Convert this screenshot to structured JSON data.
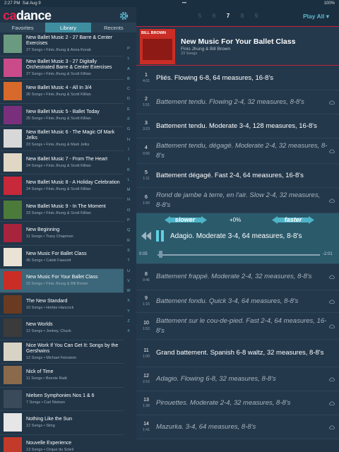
{
  "status": {
    "time": "2:27 PM",
    "date": "Sat Aug 9",
    "dots": "•••",
    "battery": "100%"
  },
  "app": {
    "logo_c": "ca",
    "logo_d": "dance",
    "accent": "#e0224f"
  },
  "tabs": [
    "Favorites",
    "Library",
    "Recents"
  ],
  "library": [
    {
      "title": "New Ballet Music 2 - 27 Barre & Center Exercises",
      "meta": "27 Songs • Finis Jhung & Anna Korab",
      "color": "#6a9a7f"
    },
    {
      "title": "New Ballet Music 3 - 27 Digitally Orchestrated Barre & Center Exercises",
      "meta": "27 Songs • Finis Jhung & Scott Killian",
      "color": "#c94b8a"
    },
    {
      "title": "New Ballet Music 4 - All In 3/4",
      "meta": "26 Songs • Finis Jhung & Scott Killian",
      "color": "#d76a2b"
    },
    {
      "title": "New Ballet Music 5 - Ballet Today",
      "meta": "25 Songs • Finis Jhung & Scott Killian",
      "color": "#7a2f7c"
    },
    {
      "title": "New Ballet Music 6 - The Magic Of Mark Jelks",
      "meta": "23 Songs • Finis Jhung & Mark Jelks",
      "color": "#d8d8d8"
    },
    {
      "title": "New Ballet Music 7 - From The Heart",
      "meta": "24 Songs • Finis Jhung & Scott Killian",
      "color": "#e0d7c4"
    },
    {
      "title": "New Ballet Music 8 - A Holiday Celebration",
      "meta": "24 Songs • Finis Jhung & Scott Killian",
      "color": "#c7283a"
    },
    {
      "title": "New Ballet Music 9 - In The Moment",
      "meta": "23 Songs • Finis Jhung & Scott Killian",
      "color": "#4c7a3a"
    },
    {
      "title": "New Beginning",
      "meta": "11 Songs • Tracy Chapman",
      "color": "#a8233c"
    },
    {
      "title": "New Music For Ballet Class",
      "meta": "45 Songs • Caleb Fawcett",
      "color": "#e9e2d5"
    },
    {
      "title": "New Music For Your Ballet Class",
      "meta": "23 Songs • Finis Jhung & Bill Brown",
      "color": "#c92d25"
    },
    {
      "title": "The New Standard",
      "meta": "10 Songs • Herbie Hancock",
      "color": "#6b3b21"
    },
    {
      "title": "New Worlds",
      "meta": "12 Songs • Jonkey, Chuck",
      "color": "#3b3b3b"
    },
    {
      "title": "Nice Work If You Can Get It: Songs by the Gershwins",
      "meta": "12 Songs • Michael Feinstein",
      "color": "#d9d3c5"
    },
    {
      "title": "Nick of Time",
      "meta": "11 Songs • Bonnie Raitt",
      "color": "#8a6a4a"
    },
    {
      "title": "Nielsen Symphonies Nos 1 & 6",
      "meta": "7 Songs • Carl Nielsen",
      "color": "#3a4a5a"
    },
    {
      "title": "Nothing Like the Sun",
      "meta": "12 Songs • Sting",
      "color": "#e6e6e6"
    },
    {
      "title": "Nouvelle Experience",
      "meta": "13 Songs • Cirque du Soleil",
      "color": "#c23a2a"
    }
  ],
  "alphabet": [
    "P",
    "L",
    "A",
    "B",
    "C",
    "D",
    "E",
    "F",
    "G",
    "H",
    "I",
    "J",
    "K",
    "L",
    "M",
    "N",
    "O",
    "P",
    "Q",
    "R",
    "S",
    "T",
    "U",
    "V",
    "W",
    "X",
    "Y",
    "Z",
    "#"
  ],
  "pages": [
    "5",
    "6",
    "7",
    "8",
    "9"
  ],
  "play_all": "Play All",
  "album": {
    "title": "New Music For Your Ballet Class",
    "artist": "Finis Jhung & Bill Brown",
    "count": "23 Songs",
    "cover_text": "BILL BROWN"
  },
  "tracks": [
    {
      "n": "1",
      "d": "4:01",
      "title": "Pliés. Flowing 6-8, 64 measures, 16-8's",
      "italic": false,
      "h": 34
    },
    {
      "n": "2",
      "d": "1:51",
      "title": "Battement tendu. Flowing 2-4, 32 measures, 8-8's",
      "italic": true,
      "h": 34
    },
    {
      "n": "3",
      "d": "3:23",
      "title": "Battement tendu. Moderate 3-4, 128 measures, 16-8's",
      "italic": false,
      "h": 34
    },
    {
      "n": "4",
      "d": "0:56",
      "title": "Battement tendu, dégagé. Moderate 2-4, 32 measures, 8-8's",
      "italic": true,
      "h": 36
    },
    {
      "n": "5",
      "d": "1:11",
      "title": "Battement dégagé. Fast 2-4, 64 measures, 16-8's",
      "italic": false,
      "h": 34
    },
    {
      "n": "6",
      "d": "1:50",
      "title": "Rond de jambe à terre, en l'air. Slow 2-4, 32 measures, 8-8's",
      "italic": true,
      "h": 36
    },
    {
      "player": true
    },
    {
      "n": "8",
      "d": "0:46",
      "title": "Battement frappé. Moderate 2-4, 32 measures, 8-8's",
      "italic": true,
      "h": 37
    },
    {
      "n": "9",
      "d": "1:15",
      "title": "Battement fondu. Quick 3-4, 64 measures, 8-8's",
      "italic": true,
      "h": 32
    },
    {
      "n": "10",
      "d": "1:53",
      "title": "Battement sur le cou-de-pied. Fast 2-4, 64 measures, 16-8's",
      "italic": true,
      "h": 38
    },
    {
      "n": "11",
      "d": "1:09",
      "title": "Grand battement. Spanish 6-8 waltz, 32 measures, 8-8's",
      "italic": false,
      "h": 39
    },
    {
      "n": "12",
      "d": "2:16",
      "title": "Adagio. Flowing 6-8, 32 measures, 8-8's",
      "italic": true,
      "h": 34
    },
    {
      "n": "13",
      "d": "1:38",
      "title": "Pirouettes. Moderate 2-4, 32 measures, 8-8's",
      "italic": true,
      "h": 34
    },
    {
      "n": "14",
      "d": "1:41",
      "title": "Mazurka. 3-4, 64 measures, 8-8's",
      "italic": true,
      "h": 34
    }
  ],
  "player": {
    "slower": "slower",
    "faster": "faster",
    "tempo": "+0%",
    "title": "Adagio. Moderate 3-4, 64 measures, 8-8's",
    "elapsed": "0:05",
    "remaining": "-2:01",
    "progress": 0.02
  }
}
